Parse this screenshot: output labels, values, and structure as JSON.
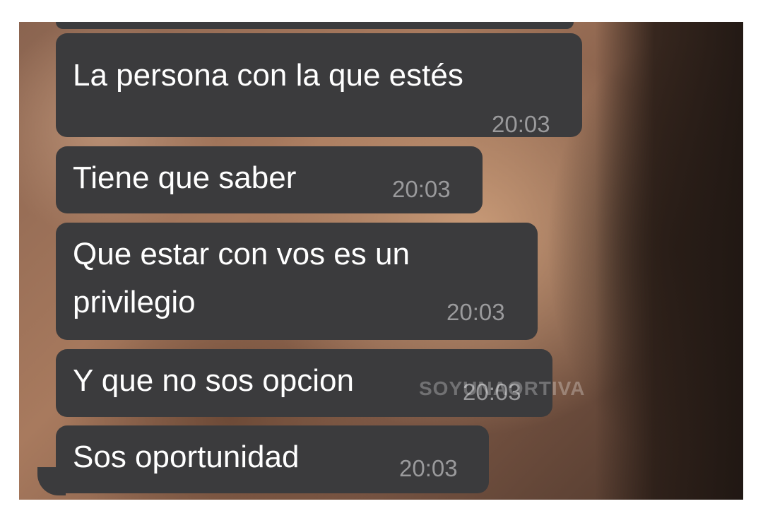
{
  "chat": {
    "messages": [
      {
        "text": "La persona con la que estés",
        "time": "20:03"
      },
      {
        "text": "Tiene que saber",
        "time": "20:03"
      },
      {
        "text_line1": "Que estar con vos es un",
        "text_line2": "privilegio",
        "time": "20:03"
      },
      {
        "text": "Y que no sos opcion",
        "time": "20:03"
      },
      {
        "text": "Sos oportunidad",
        "time": "20:03"
      }
    ]
  },
  "watermark": "SOYUNAORTIVA",
  "colors": {
    "bubble": "#3b3b3d",
    "text": "#ffffff",
    "timestamp": "#9a9a9c"
  }
}
